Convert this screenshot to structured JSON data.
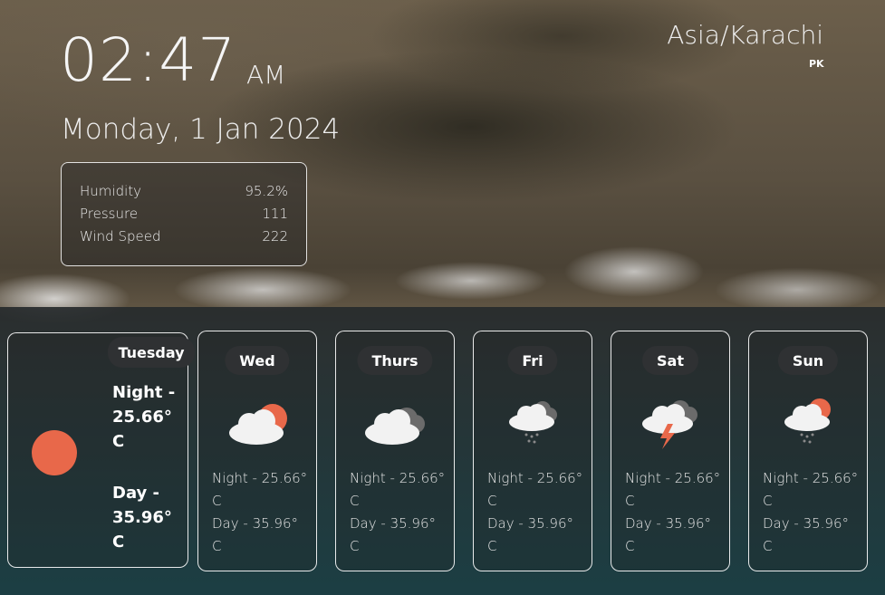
{
  "clock": {
    "time": "02:47",
    "ampm": "AM",
    "date": "Monday, 1 Jan 2024"
  },
  "location": {
    "timezone": "Asia/Karachi",
    "country": "PK"
  },
  "stats": [
    {
      "label": "Humidity",
      "value": "95.2%"
    },
    {
      "label": "Pressure",
      "value": "111"
    },
    {
      "label": "Wind Speed",
      "value": "222"
    }
  ],
  "today": {
    "day": "Tuesday",
    "night": "Night - 25.66° C",
    "day_temp": "Day - 35.96° C",
    "icon": "sun-icon"
  },
  "forecast": [
    {
      "day": "Wed",
      "icon": "partly-cloudy-icon",
      "night": "Night - 25.66° C",
      "day_temp": "Day - 35.96° C"
    },
    {
      "day": "Thurs",
      "icon": "cloudy-icon",
      "night": "Night - 25.66° C",
      "day_temp": "Day - 35.96° C"
    },
    {
      "day": "Fri",
      "icon": "rain-icon",
      "night": "Night - 25.66° C",
      "day_temp": "Day - 35.96° C"
    },
    {
      "day": "Sat",
      "icon": "thunderstorm-icon",
      "night": "Night - 25.66° C",
      "day_temp": "Day - 35.96° C"
    },
    {
      "day": "Sun",
      "icon": "sun-rain-icon",
      "night": "Night - 25.66° C",
      "day_temp": "Day - 35.96° C"
    }
  ],
  "colors": {
    "sun": "#e8684a",
    "cloud": "#f2f2f2",
    "dark_cloud": "#6b6b6b",
    "bolt": "#e8684a"
  }
}
